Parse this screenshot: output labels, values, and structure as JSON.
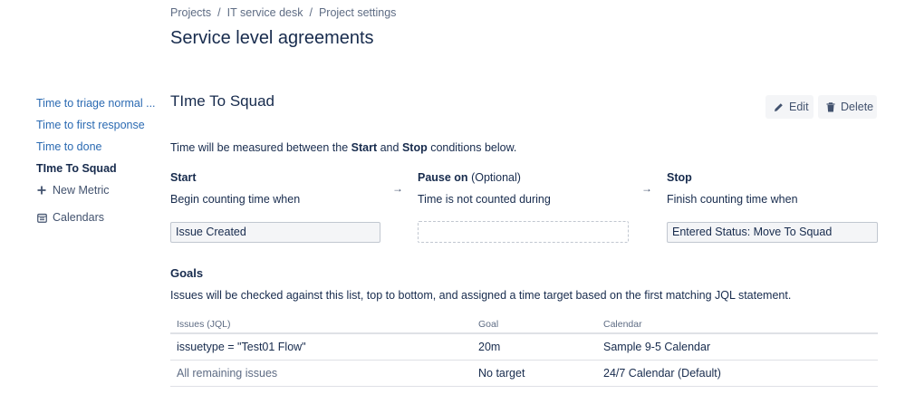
{
  "breadcrumb": {
    "items": [
      "Projects",
      "IT service desk",
      "Project settings"
    ],
    "separator": "/"
  },
  "page_title": "Service level agreements",
  "sidebar": {
    "items": [
      {
        "label": "Time to triage normal ..."
      },
      {
        "label": "Time to first response"
      },
      {
        "label": "Time to done"
      },
      {
        "label": "TIme To Squad",
        "active": true
      }
    ],
    "new_metric": {
      "label": "New Metric",
      "icon": "plus-icon"
    },
    "calendars": {
      "label": "Calendars",
      "icon": "calendar-icon"
    }
  },
  "metric": {
    "title": "TIme To Squad",
    "edit_label": "Edit",
    "delete_label": "Delete",
    "measure": {
      "prefix": "Time will be measured between the ",
      "start_word": "Start",
      "and": " and ",
      "stop_word": "Stop",
      "suffix": " conditions below."
    },
    "conditions": {
      "start": {
        "heading": "Start",
        "sub": "Begin counting time when",
        "value": "Issue Created"
      },
      "pause": {
        "heading": "Pause on",
        "optional": "(Optional)",
        "sub": "Time is not counted during",
        "value": ""
      },
      "stop": {
        "heading": "Stop",
        "sub": "Finish counting time when",
        "value": "Entered Status: Move To Squad"
      },
      "arrow": "→"
    }
  },
  "goals": {
    "heading": "Goals",
    "description": "Issues will be checked against this list, top to bottom, and assigned a time target based on the first matching JQL statement.",
    "columns": [
      "Issues (JQL)",
      "Goal",
      "Calendar"
    ],
    "rows": [
      {
        "issues": "issuetype = \"Test01 Flow\"",
        "goal": "20m",
        "calendar": "Sample 9-5 Calendar"
      },
      {
        "issues": "All remaining issues",
        "goal": "No target",
        "calendar": "24/7 Calendar (Default)"
      }
    ]
  },
  "colors": {
    "link": "#2b6ab2",
    "text": "#172b4d",
    "muted": "#5e6c84",
    "button_bg": "#f4f5f7"
  }
}
